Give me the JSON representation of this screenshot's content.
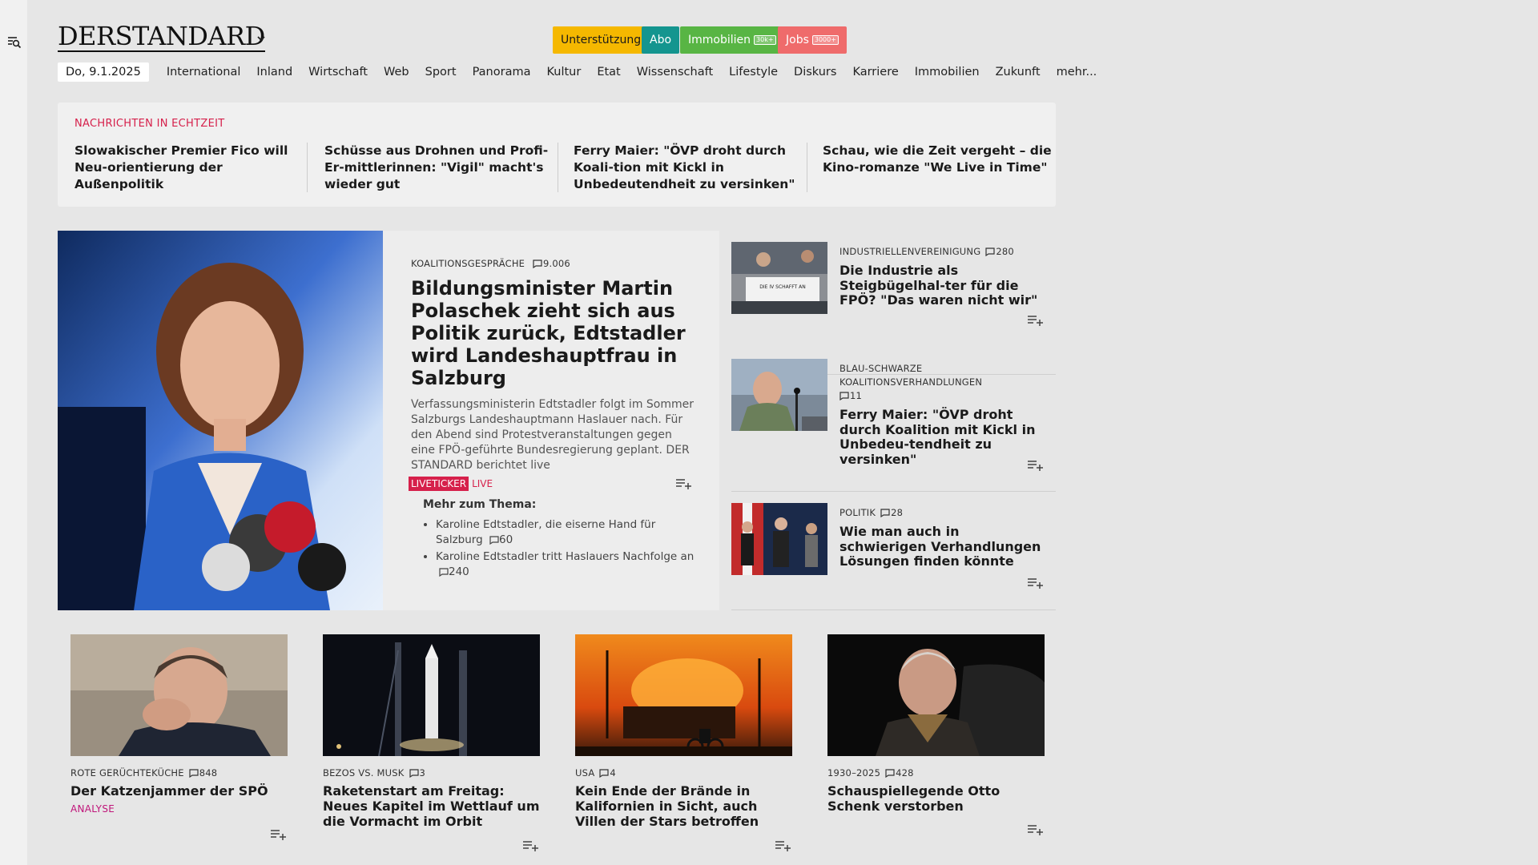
{
  "brand": {
    "logo": "DERSTANDARD"
  },
  "top_pills": [
    {
      "label": "Unterstützung",
      "badge": "",
      "color": "#f5b800"
    },
    {
      "label": "Abo",
      "badge": "",
      "color": "#14958f"
    },
    {
      "label": "Immobilien",
      "badge": "30k+",
      "color": "#58b544"
    },
    {
      "label": "Jobs",
      "badge": "3000+",
      "color": "#ef6b6b"
    }
  ],
  "nav": {
    "date": "Do, 9.1.2025",
    "items": [
      "International",
      "Inland",
      "Wirtschaft",
      "Web",
      "Sport",
      "Panorama",
      "Kultur",
      "Etat",
      "Wissenschaft",
      "Lifestyle",
      "Diskurs",
      "Karriere",
      "Immobilien",
      "Zukunft",
      "mehr..."
    ]
  },
  "realtime": {
    "title": "NACHRICHTEN IN ECHTZEIT",
    "items": [
      "Slowakischer Premier Fico will Neu-orientierung der Außenpolitik",
      "Schüsse aus Drohnen und Profi-Er-mittlerinnen: \"Vigil\" macht's wieder gut",
      "Ferry Maier: \"ÖVP droht durch Koali-tion mit Kickl in Unbedeutendheit zu versinken\"",
      "Schau, wie die Zeit vergeht – die Kino-romanze \"We Live in Time\""
    ]
  },
  "lead": {
    "kicker": "KOALITIONSGESPRÄCHE",
    "comments": "9.006",
    "headline": "Bildungsminister Martin Polaschek zieht sich aus Politik zurück, Edtstadler wird Landeshauptfrau in Salzburg",
    "description": "Verfassungsministerin Edtstadler folgt im Sommer Salzburgs Landeshauptmann Haslauer nach. Für den Abend sind Protestveranstaltungen gegen eine FPÖ-geführte Bundesregierung geplant. DER STANDARD berichtet live",
    "tag": "LIVETICKER",
    "live_label": "LIVE",
    "more_title": "Mehr zum Thema:",
    "more": [
      {
        "title": "Karoline Edtstadler, die eiserne Hand für Salzburg",
        "comments": "60"
      },
      {
        "title": "Karoline Edtstadler tritt Haslauers Nachfolge an",
        "comments": "240"
      }
    ]
  },
  "side": [
    {
      "kicker": "INDUSTRIELLENVEREINIGUNG",
      "comments": "280",
      "headline": "Die Industrie als Steigbügelhal-ter für die FPÖ? \"Das waren nicht wir\"",
      "banner": "DIE IV SCHAFFT AN"
    },
    {
      "kicker": "BLAU-SCHWARZE KOALITIONSVERHANDLUNGEN",
      "comments": "11",
      "headline": "Ferry Maier: \"ÖVP droht durch Koalition mit Kickl in Unbedeu-tendheit zu versinken\""
    },
    {
      "kicker": "POLITIK",
      "comments": "28",
      "headline": "Wie man auch in schwierigen Verhandlungen Lösungen finden könnte"
    }
  ],
  "bottom": [
    {
      "kicker": "ROTE GERÜCHTEKÜCHE",
      "comments": "848",
      "headline": "Der Katzenjammer der SPÖ",
      "label": "ANALYSE"
    },
    {
      "kicker": "BEZOS VS. MUSK",
      "comments": "3",
      "headline": "Raketenstart am Freitag: Neues Kapitel im Wettlauf um die Vormacht im Orbit",
      "label": ""
    },
    {
      "kicker": "USA",
      "comments": "4",
      "headline": "Kein Ende der Brände in Kalifornien in Sicht, auch Villen der Stars betroffen",
      "label": ""
    },
    {
      "kicker": "1930–2025",
      "comments": "428",
      "headline": "Schauspiellegende Otto Schenk verstorben",
      "label": ""
    }
  ]
}
